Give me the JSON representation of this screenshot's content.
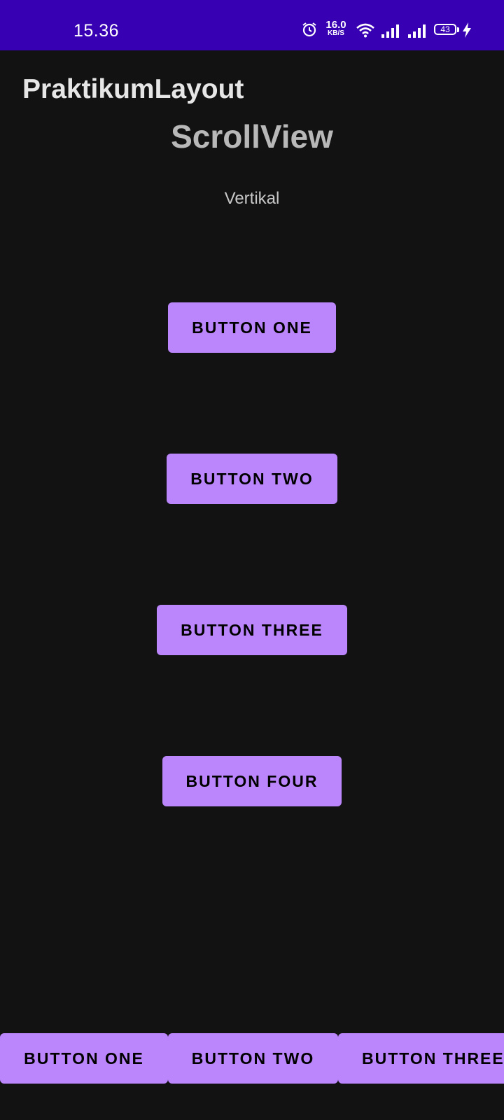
{
  "status_bar": {
    "time": "15.36",
    "speed_value": "16.0",
    "speed_unit": "KB/S",
    "battery": "43",
    "icons": [
      "alarm-icon",
      "wifi-icon",
      "signal-icon",
      "signal-icon",
      "battery-icon",
      "charging-bolt-icon"
    ],
    "background": "#3700b3"
  },
  "app_bar": {
    "title": "PraktikumLayout"
  },
  "content": {
    "heading": "ScrollView",
    "subheading": "Vertikal",
    "vertical_buttons": [
      "BUTTON ONE",
      "BUTTON TWO",
      "BUTTON THREE",
      "BUTTON FOUR"
    ]
  },
  "horizontal_scroll": {
    "buttons": [
      "BUTTON ONE",
      "BUTTON TWO",
      "BUTTON THREE"
    ]
  },
  "colors": {
    "background": "#121212",
    "button": "#bb86fc",
    "button_text": "#000000"
  }
}
